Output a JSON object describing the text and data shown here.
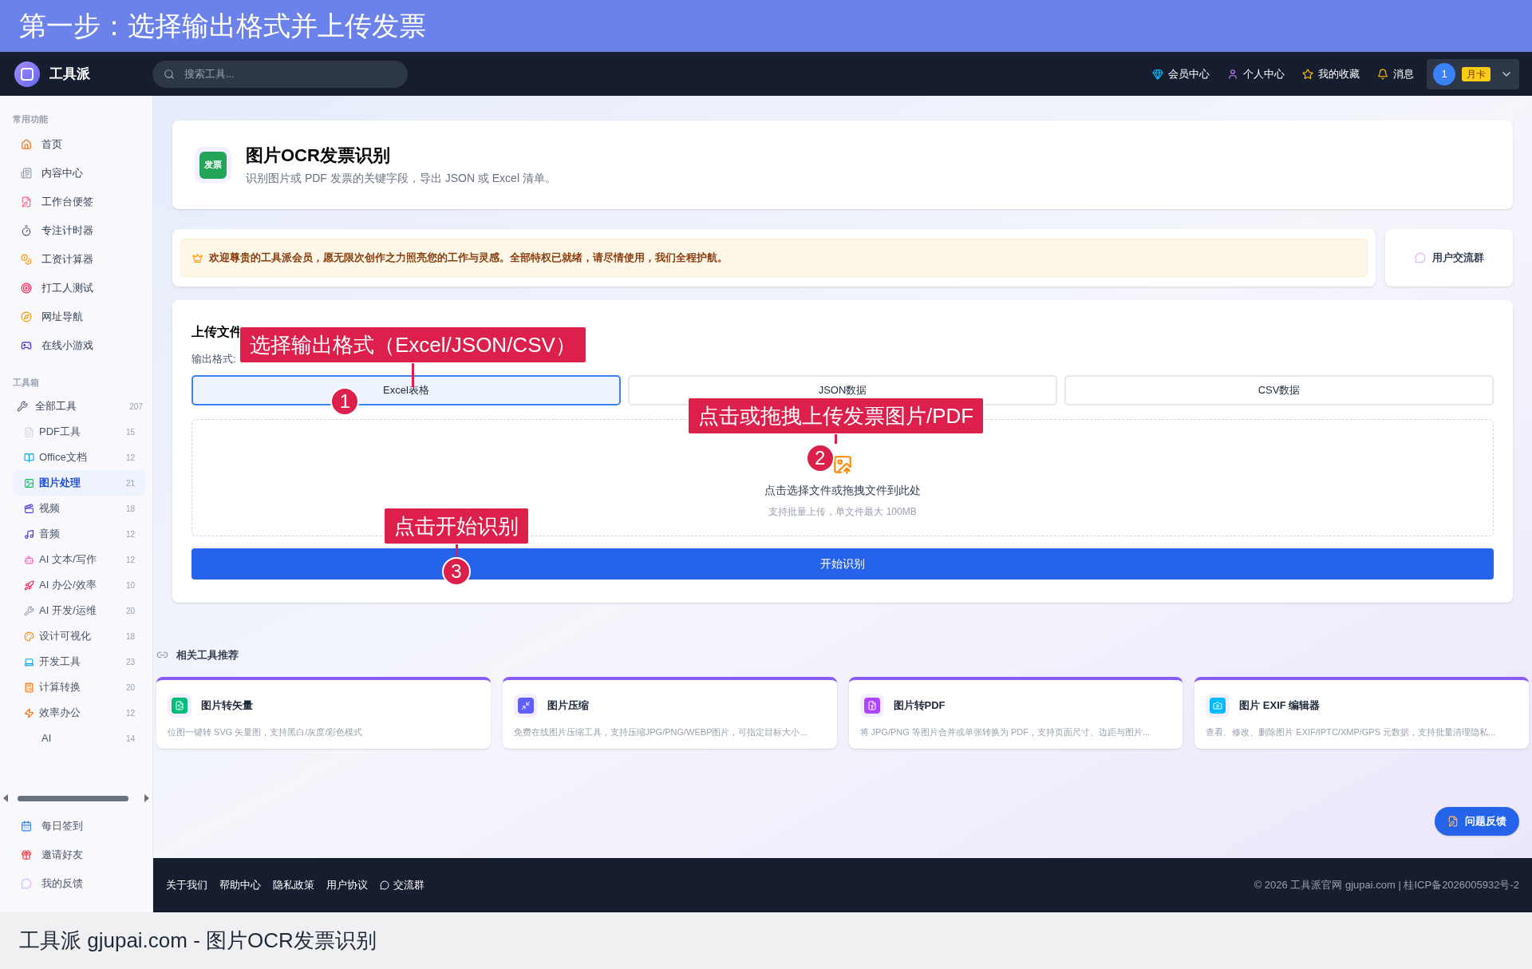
{
  "banner": {
    "title": "第一步：选择输出格式并上传发票"
  },
  "nav": {
    "logo": "工具派",
    "search": {
      "placeholder": "搜索工具..."
    },
    "links": [
      "会员中心",
      "个人中心",
      "我的收藏",
      "消息"
    ],
    "user": {
      "avatar": "1",
      "badge": "月卡"
    }
  },
  "sidebar": {
    "common": {
      "heading": "常用功能",
      "items": [
        "首页",
        "内容中心",
        "工作台便签",
        "专注计时器",
        "工资计算器",
        "打工人测试",
        "网址导航",
        "在线小游戏"
      ]
    },
    "toolbox": {
      "heading": "工具箱",
      "all": {
        "label": "全部工具",
        "count": "207"
      },
      "items": [
        {
          "label": "PDF工具",
          "count": "15",
          "selected": false
        },
        {
          "label": "Office文档",
          "count": "12",
          "selected": false
        },
        {
          "label": "图片处理",
          "count": "21",
          "selected": true
        },
        {
          "label": "视频",
          "count": "18",
          "selected": false
        },
        {
          "label": "音频",
          "count": "12",
          "selected": false
        },
        {
          "label": "AI 文本/写作",
          "count": "12",
          "selected": false
        },
        {
          "label": "AI 办公/效率",
          "count": "10",
          "selected": false
        },
        {
          "label": "AI 开发/运维",
          "count": "20",
          "selected": false
        },
        {
          "label": "设计可视化",
          "count": "18",
          "selected": false
        },
        {
          "label": "开发工具",
          "count": "23",
          "selected": false
        },
        {
          "label": "计算转换",
          "count": "20",
          "selected": false
        },
        {
          "label": "效率办公",
          "count": "12",
          "selected": false
        },
        {
          "label": "AI",
          "count": "14",
          "selected": false
        }
      ]
    },
    "bottom": [
      "每日签到",
      "邀请好友",
      "我的反馈"
    ]
  },
  "header": {
    "icon_text": "发票",
    "title": "图片OCR发票识别",
    "subtitle": "识别图片或 PDF 发票的关键字段，导出 JSON 或 Excel 清单。"
  },
  "notice": {
    "text": "欢迎尊贵的工具派会员，愿无限次创作之力照亮您的工作与灵感。全部特权已就绪，请尽情使用，我们全程护航。"
  },
  "community_button": "用户交流群",
  "upload": {
    "title": "上传文件",
    "format_label": "输出格式:",
    "formats": [
      {
        "label": "Excel表格",
        "selected": true
      },
      {
        "label": "JSON数据",
        "selected": false
      },
      {
        "label": "CSV数据",
        "selected": false
      }
    ],
    "dropzone": {
      "text": "点击选择文件或拖拽文件到此处",
      "hint": "支持批量上传，单文件最大 100MB"
    },
    "start_button": "开始识别"
  },
  "annotations": [
    {
      "number": "1",
      "text": "选择输出格式（Excel/JSON/CSV）"
    },
    {
      "number": "2",
      "text": "点击或拖拽上传发票图片/PDF"
    },
    {
      "number": "3",
      "text": "点击开始识别"
    }
  ],
  "related": {
    "title": "相关工具推荐",
    "tools": [
      {
        "title": "图片转矢量",
        "desc": "位图一键转 SVG 矢量图，支持黑白/灰度/彩色模式"
      },
      {
        "title": "图片压缩",
        "desc": "免费在线图片压缩工具，支持压缩JPG/PNG/WEBP图片，可指定目标大小..."
      },
      {
        "title": "图片转PDF",
        "desc": "将 JPG/PNG 等图片合并或单张转换为 PDF，支持页面尺寸、边距与图片..."
      },
      {
        "title": "图片 EXIF 编辑器",
        "desc": "查看、修改、删除图片 EXIF/IPTC/XMP/GPS 元数据，支持批量清理隐私..."
      }
    ]
  },
  "feedback_button": "问题反馈",
  "footer": {
    "links": [
      "关于我们",
      "帮助中心",
      "隐私政策",
      "用户协议",
      "交流群"
    ],
    "copyright": "© 2026 工具派官网 gjupai.com | 桂ICP备2026005932号-2"
  },
  "caption": "工具派 gjupai.com - 图片OCR发票识别"
}
